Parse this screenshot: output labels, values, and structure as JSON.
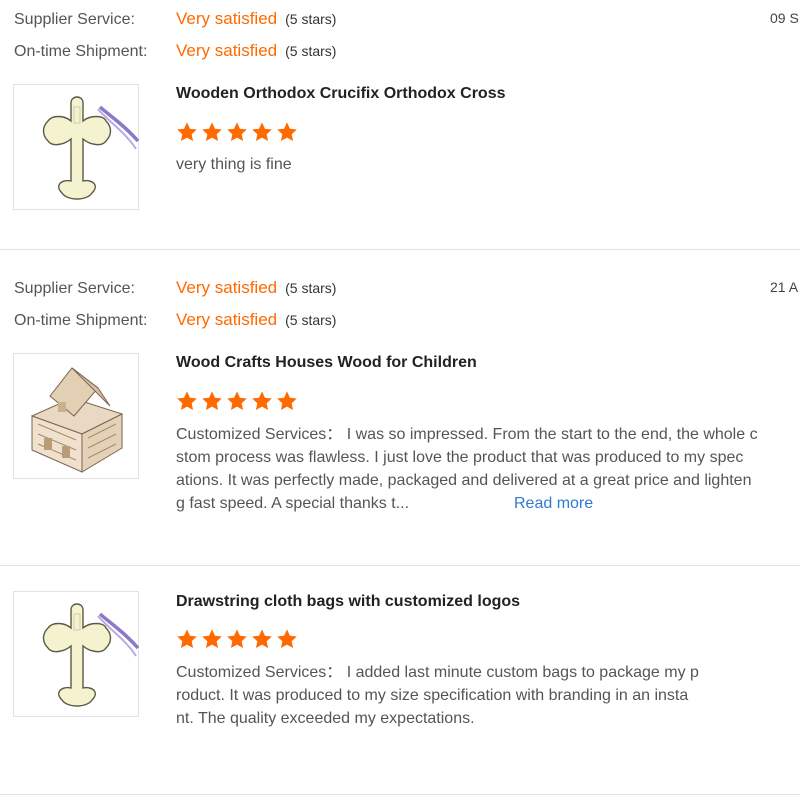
{
  "colors": {
    "accent": "#ff6a00",
    "link": "#2e7bd3"
  },
  "reviews": [
    {
      "supplier_label": "Supplier Service:",
      "supplier_value": "Very satisfied",
      "supplier_stars": "(5 stars)",
      "shipment_label": "On-time Shipment:",
      "shipment_value": "Very satisfied",
      "shipment_stars": "(5 stars)",
      "date": "09 S",
      "product_title": "Wooden Orthodox Crucifix Orthodox Cross",
      "product_image": "wooden-cross-icon",
      "rating": 5,
      "comment_lines": [
        "very thing is fine"
      ]
    },
    {
      "supplier_label": "Supplier Service:",
      "supplier_value": "Very satisfied",
      "supplier_stars": "(5 stars)",
      "shipment_label": "On-time Shipment:",
      "shipment_value": "Very satisfied",
      "shipment_stars": "(5 stars)",
      "date": "21 A",
      "product_title": "Wood Crafts Houses Wood for Children",
      "product_image": "wooden-house-icon",
      "rating": 5,
      "comment_lines": [
        "Customized Services：  I was so impressed. From the start to the end, the whole c",
        "stom process was flawless. I just love the product that was produced to my spec",
        "ations. It was perfectly made, packaged and delivered at a great price and lighten",
        "g fast speed. A special thanks t..."
      ],
      "read_more": "Read more"
    },
    {
      "product_title": "Drawstring cloth bags with customized logos",
      "product_image": "wooden-cross-icon",
      "rating": 5,
      "comment_lines": [
        "Customized Services：  I added last minute custom bags to package my p",
        "roduct. It was produced to my size specification with branding in an insta",
        "nt. The quality exceeded my expectations."
      ]
    }
  ]
}
